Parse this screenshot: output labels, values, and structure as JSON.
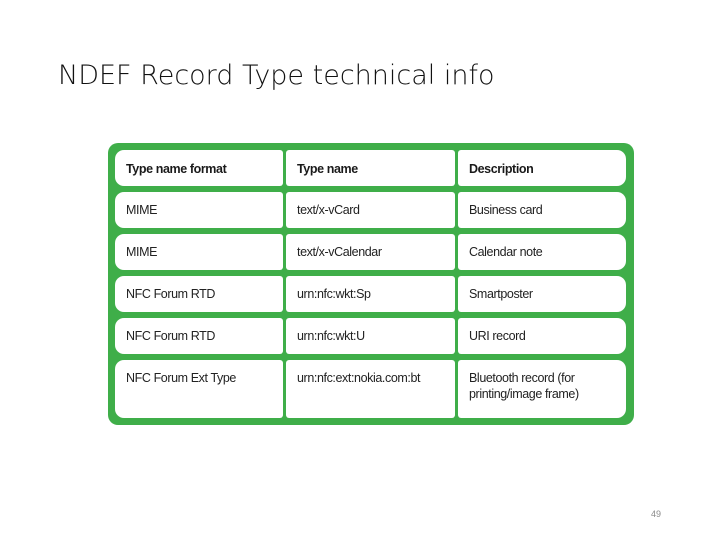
{
  "slide": {
    "title": "NDEF Record Type technical info",
    "page_number": "49"
  },
  "table": {
    "accent_color": "#3fae49",
    "headers": [
      "Type name format",
      "Type name",
      "Description"
    ],
    "rows": [
      [
        "MIME",
        "text/x-vCard",
        "Business card"
      ],
      [
        "MIME",
        "text/x-vCalendar",
        "Calendar note"
      ],
      [
        "NFC Forum RTD",
        "urn:nfc:wkt:Sp",
        "Smartposter"
      ],
      [
        "NFC Forum RTD",
        "urn:nfc:wkt:U",
        "URI record"
      ],
      [
        "NFC Forum Ext Type",
        "urn:nfc:ext:nokia.com:bt",
        "Bluetooth record (for printing/image frame)"
      ]
    ]
  }
}
